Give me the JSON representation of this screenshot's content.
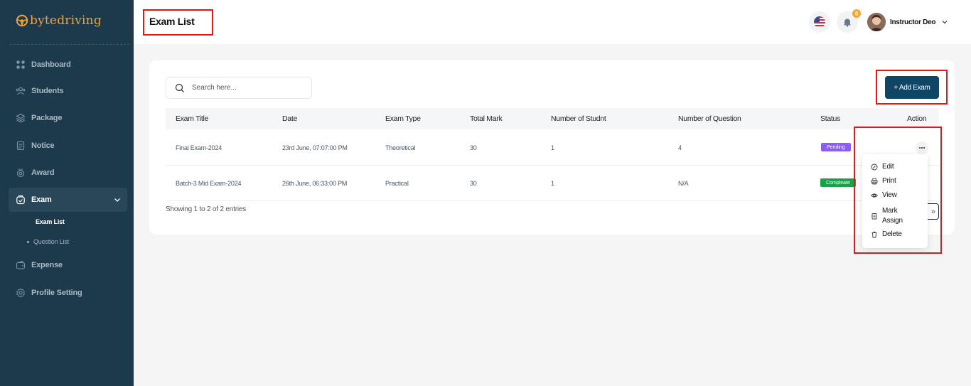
{
  "brand": {
    "part1": "byte",
    "part2": "driving"
  },
  "sidebar": {
    "items": [
      {
        "label": "Dashboard",
        "icon": "grid-icon"
      },
      {
        "label": "Students",
        "icon": "users-icon"
      },
      {
        "label": "Package",
        "icon": "layers-icon"
      },
      {
        "label": "Notice",
        "icon": "document-icon"
      },
      {
        "label": "Award",
        "icon": "award-icon"
      },
      {
        "label": "Exam",
        "icon": "exam-icon"
      },
      {
        "label": "Expense",
        "icon": "wallet-icon"
      },
      {
        "label": "Profile Setting",
        "icon": "gear-icon"
      }
    ],
    "exam_sub": [
      {
        "label": "Exam List"
      },
      {
        "label": "Question List"
      }
    ]
  },
  "header": {
    "title": "Exam List",
    "notification_count": "0",
    "user_name": "Instructor Deo"
  },
  "toolbar": {
    "search_placeholder": "Search here...",
    "add_label": "+ Add Exam"
  },
  "table": {
    "columns": [
      "Exam Title",
      "Date",
      "Exam Type",
      "Total Mark",
      "Number of Studnt",
      "Number of Question",
      "Status",
      "Action"
    ],
    "rows": [
      {
        "title": "Final Exam-2024",
        "date": "23rd June, 07:07:00 PM",
        "type": "Theoretical",
        "total": "30",
        "students": "1",
        "questions": "4",
        "status": "Pending"
      },
      {
        "title": "Batch-3 Mid Exam-2024",
        "date": "26th June, 06:33:00 PM",
        "type": "Practical",
        "total": "30",
        "students": "1",
        "questions": "N/A",
        "status": "Compleate"
      }
    ],
    "entries_text": "Showing 1 to 2 of 2 entries",
    "next_label": "»"
  },
  "action_menu": {
    "edit": "Edit",
    "print": "Print",
    "view": "View",
    "mark_assign_1": "Mark",
    "mark_assign_2": "Assign",
    "delete": "Delete"
  },
  "colors": {
    "sidebar": "#1d3a4d",
    "primary": "#0f4565",
    "accent": "#f2a33a",
    "pending": "#8b5cf6",
    "complete": "#16a34a",
    "highlight": "#e01818"
  }
}
